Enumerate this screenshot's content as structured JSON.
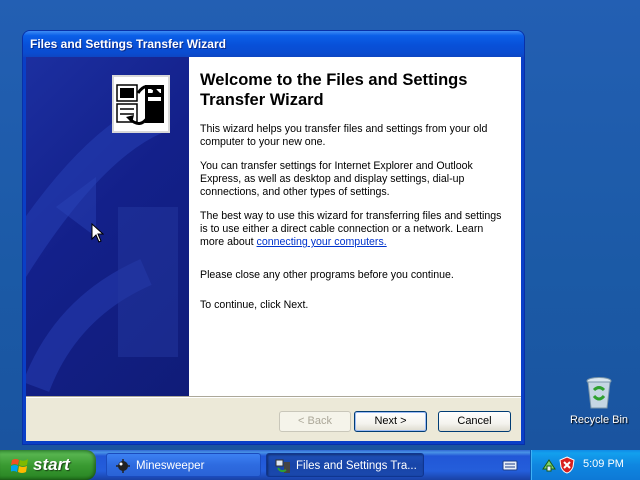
{
  "window": {
    "title": "Files and Settings Transfer Wizard"
  },
  "wizard": {
    "heading": "Welcome to the Files and Settings Transfer Wizard",
    "paragraph1": "This wizard helps you transfer files and settings from your old computer to your new one.",
    "paragraph2": "You can transfer settings for Internet Explorer and Outlook Express, as well as desktop and display settings, dial-up connections, and other types of settings.",
    "paragraph3_prefix": "The best way to use this wizard for transferring files and settings is to use either a direct cable connection or a network. Learn more about ",
    "paragraph3_link": "connecting your computers.",
    "paragraph4": "Please close any other programs before you continue.",
    "paragraph5": "To continue, click Next.",
    "buttons": {
      "back": "< Back",
      "next": "Next >",
      "cancel": "Cancel"
    },
    "icon": "transfer-wizard-icon"
  },
  "desktop": {
    "recycle_bin_label": "Recycle Bin"
  },
  "taskbar": {
    "start_label": "start",
    "tasks": [
      {
        "label": "Minesweeper",
        "icon": "minesweeper-icon",
        "active": false
      },
      {
        "label": "Files and Settings Tra...",
        "icon": "transfer-wizard-icon",
        "active": true
      }
    ],
    "clock": "5:09 PM",
    "tray_icons": [
      "keyboard-icon",
      "network-icon",
      "security-shield-icon"
    ]
  },
  "colors": {
    "desktop_bg": "#1d5fa8",
    "titlebar": "#0a5fe8",
    "wizard_side_panel": "#13208a",
    "taskbar": "#245edb",
    "start_button": "#3a9b32",
    "link": "#0033cc"
  }
}
